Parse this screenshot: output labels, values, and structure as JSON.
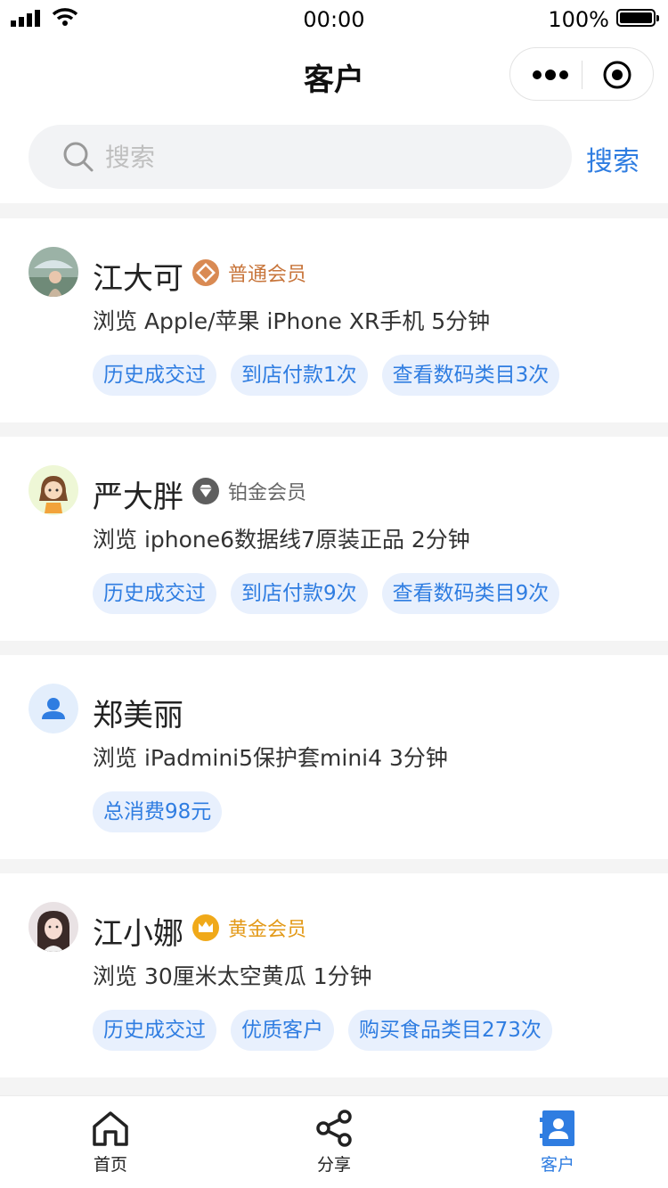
{
  "status_bar": {
    "time": "00:00",
    "battery": "100%"
  },
  "nav": {
    "title": "客户",
    "more_icon": "more-dots-icon",
    "close_icon": "target-icon"
  },
  "search": {
    "placeholder": "搜索",
    "button_label": "搜索"
  },
  "customers": [
    {
      "name": "江大可",
      "level": "普通会员",
      "level_icon": "bronze-diamond-icon",
      "level_color": "#c8763c",
      "avatar": "photo-avatar",
      "browse": "浏览 Apple/苹果 iPhone XR手机 5分钟",
      "tags": [
        "历史成交过",
        "到店付款1次",
        "查看数码类目3次"
      ]
    },
    {
      "name": "严大胖",
      "level": "铂金会员",
      "level_icon": "platinum-diamond-icon",
      "level_color": "#666666",
      "avatar": "cartoon-avatar",
      "browse": "浏览 iphone6数据线7原装正品 2分钟",
      "tags": [
        "历史成交过",
        "到店付款9次",
        "查看数码类目9次"
      ]
    },
    {
      "name": "郑美丽",
      "level": "",
      "level_icon": "",
      "level_color": "",
      "avatar": "default-user-avatar",
      "browse": "浏览 iPadmini5保护套mini4 3分钟",
      "tags": [
        "总消费98元"
      ]
    },
    {
      "name": "江小娜",
      "level": "黄金会员",
      "level_icon": "gold-crown-icon",
      "level_color": "#e39a19",
      "avatar": "photo-avatar",
      "browse": "浏览 30厘米太空黄瓜 1分钟",
      "tags": [
        "历史成交过",
        "优质客户",
        "购买食品类目273次"
      ]
    }
  ],
  "tabbar": [
    {
      "label": "首页",
      "icon": "home-icon",
      "active": false
    },
    {
      "label": "分享",
      "icon": "share-icon",
      "active": false
    },
    {
      "label": "客户",
      "icon": "contacts-icon",
      "active": true
    }
  ],
  "colors": {
    "accent": "#2f7de1",
    "tag_bg": "#e8f0fd"
  }
}
